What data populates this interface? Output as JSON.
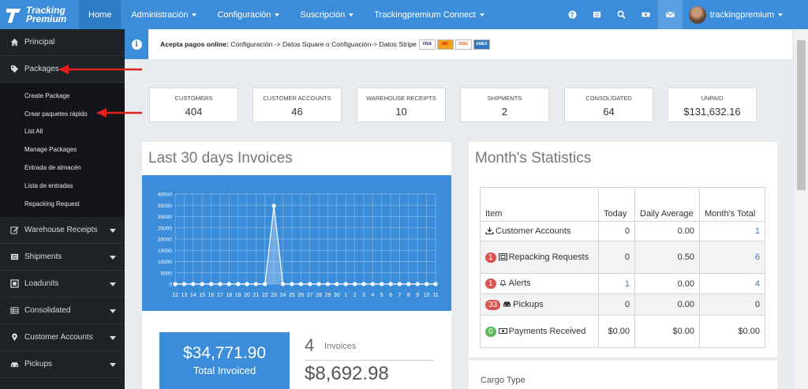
{
  "brand": {
    "line1": "Tracking",
    "line2": "Premium"
  },
  "nav": {
    "home": "Home",
    "items": [
      "Administración",
      "Configuración",
      "Suscripción",
      "Trackingpremium Connect"
    ],
    "user": "trackingpremium"
  },
  "sidebar": {
    "top": [
      {
        "label": "Principal",
        "icon": "home-icon"
      },
      {
        "label": "Packages",
        "icon": "tags-icon"
      }
    ],
    "sub": [
      "Create Package",
      "Crear paquetes rápido",
      "List All",
      "Manage Packages",
      "Entrada de almacén",
      "Lista de entradas",
      "Repacking Request"
    ],
    "bottom": [
      {
        "label": "Warehouse Receipts",
        "icon": "edit-icon"
      },
      {
        "label": "Shipments",
        "icon": "list-icon"
      },
      {
        "label": "Loadunits",
        "icon": "box-icon"
      },
      {
        "label": "Consolidated",
        "icon": "table-icon"
      },
      {
        "label": "Customer Accounts",
        "icon": "map-marker-icon"
      },
      {
        "label": "Pickups",
        "icon": "car-icon"
      }
    ]
  },
  "notice": {
    "bold": "Acepta pagos online:",
    "text": " Configuración -> Datos Square o Configuación-> Datos Stripe",
    "cards": [
      "VISA",
      "MC",
      "DISC",
      "AMEX"
    ]
  },
  "stats": [
    {
      "label": "CUSTOMERS",
      "value": "404"
    },
    {
      "label": "CUSTOMER ACCOUNTS",
      "value": "46"
    },
    {
      "label": "WAREHOUSE RECEIPTS",
      "value": "10"
    },
    {
      "label": "SHIPMENTS",
      "value": "2"
    },
    {
      "label": "CONSOLIDATED",
      "value": "64"
    },
    {
      "label": "UNPAID",
      "value": "$131,632.16"
    }
  ],
  "invoices": {
    "title": "Last 30 days Invoices",
    "total_value": "$34,771.90",
    "total_label": "Total Invoiced",
    "count": "4",
    "count_label": "Invoices",
    "avg": "$8,692.98"
  },
  "chart_data": {
    "type": "line",
    "categories": [
      "12",
      "13",
      "14",
      "15",
      "16",
      "17",
      "18",
      "19",
      "20",
      "21",
      "22",
      "23",
      "24",
      "25",
      "26",
      "27",
      "28",
      "29",
      "30",
      "1",
      "2",
      "3",
      "4",
      "5",
      "6",
      "7",
      "8",
      "9",
      "10",
      "11"
    ],
    "values": [
      0,
      0,
      0,
      0,
      0,
      0,
      0,
      0,
      0,
      0,
      0,
      34771.9,
      0,
      0,
      0,
      0,
      0,
      0,
      0,
      0,
      0,
      0,
      0,
      0,
      0,
      0,
      0,
      0,
      0,
      0
    ],
    "yticks": [
      0,
      5000,
      10000,
      15000,
      20000,
      25000,
      30000,
      35000,
      40000
    ],
    "ylim": [
      0,
      40000
    ],
    "grid": true,
    "line_color": "#ffffff",
    "background": "#3c8dd9"
  },
  "month_stats": {
    "title": "Month's Statistics",
    "headers": [
      "Item",
      "Today",
      "Daily Average",
      "Month's Total"
    ],
    "rows": [
      {
        "badge": "",
        "icon": "download-icon",
        "item": "Customer Accounts",
        "today": "0",
        "avg": "0.00",
        "total": "1"
      },
      {
        "badge": "1",
        "icon": "repack-icon",
        "item": "Repacking Requests",
        "today": "0",
        "avg": "0.50",
        "total": "6"
      },
      {
        "badge": "1",
        "icon": "bell-icon",
        "item": "Alerts",
        "today": "1",
        "avg": "0.00",
        "total": "4"
      },
      {
        "badge": "33",
        "icon": "car-icon",
        "item": "Pickups",
        "today": "0",
        "avg": "0.00",
        "total": "0"
      },
      {
        "badge": "0",
        "icon": "money-icon",
        "item": "Payments Received",
        "today": "$0.00",
        "avg": "$0.00",
        "total": "$0.00"
      }
    ]
  },
  "cargo": {
    "title": "Cargo Type"
  },
  "colors": {
    "primary": "#3c8dd9",
    "sidebar": "#1f2327",
    "badge_red": "#d9534f",
    "badge_green": "#5cb85c",
    "arrow": "#e0201c"
  }
}
